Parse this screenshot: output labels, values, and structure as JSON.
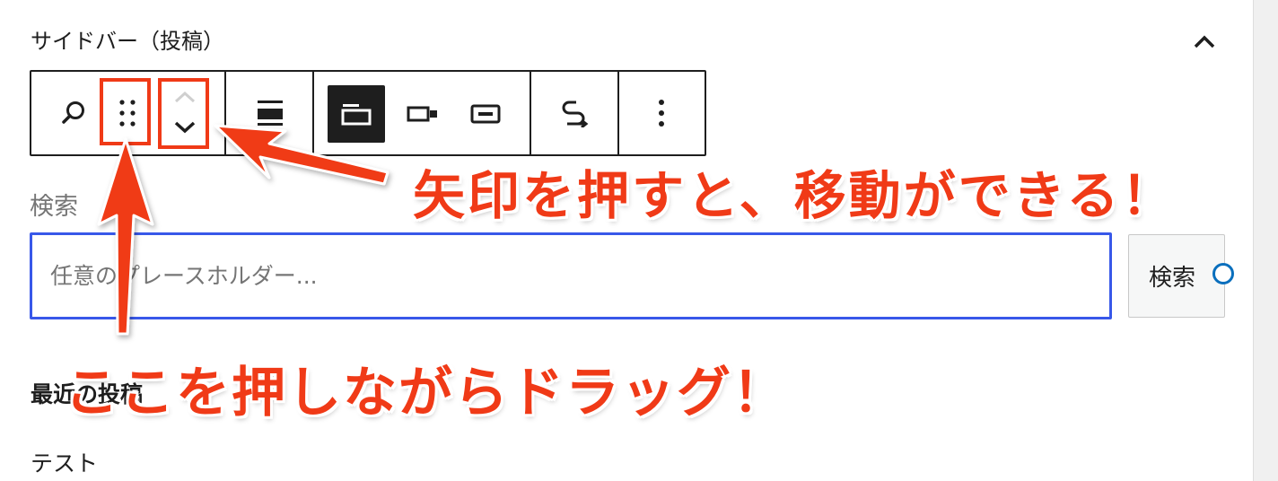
{
  "panel": {
    "title": "サイドバー（投稿）"
  },
  "toolbar": {
    "buttons": [
      {
        "icon": "search-icon"
      },
      {
        "icon": "drag-handle-icon"
      },
      {
        "icon": "move-up-icon"
      },
      {
        "icon": "move-down-icon"
      },
      {
        "icon": "align-icon"
      },
      {
        "icon": "button-outside-icon",
        "active": true
      },
      {
        "icon": "button-inside-icon"
      },
      {
        "icon": "no-button-icon"
      },
      {
        "icon": "transform-icon"
      },
      {
        "icon": "more-options-icon"
      }
    ]
  },
  "search_block": {
    "label": "検索",
    "placeholder": "任意のプレースホルダー...",
    "value": "",
    "button_label": "検索"
  },
  "recent_posts": {
    "heading": "最近の投稿",
    "items": [
      "テスト"
    ]
  },
  "annotations": {
    "move_arrows": "矢印を押すと、移動ができる！",
    "drag_handle": "ここを押しながらドラッグ！"
  },
  "colors": {
    "annotation_red": "#f03a17",
    "focus_blue": "#3858e9",
    "text_dark": "#1e1e1e",
    "text_muted": "#757575"
  }
}
